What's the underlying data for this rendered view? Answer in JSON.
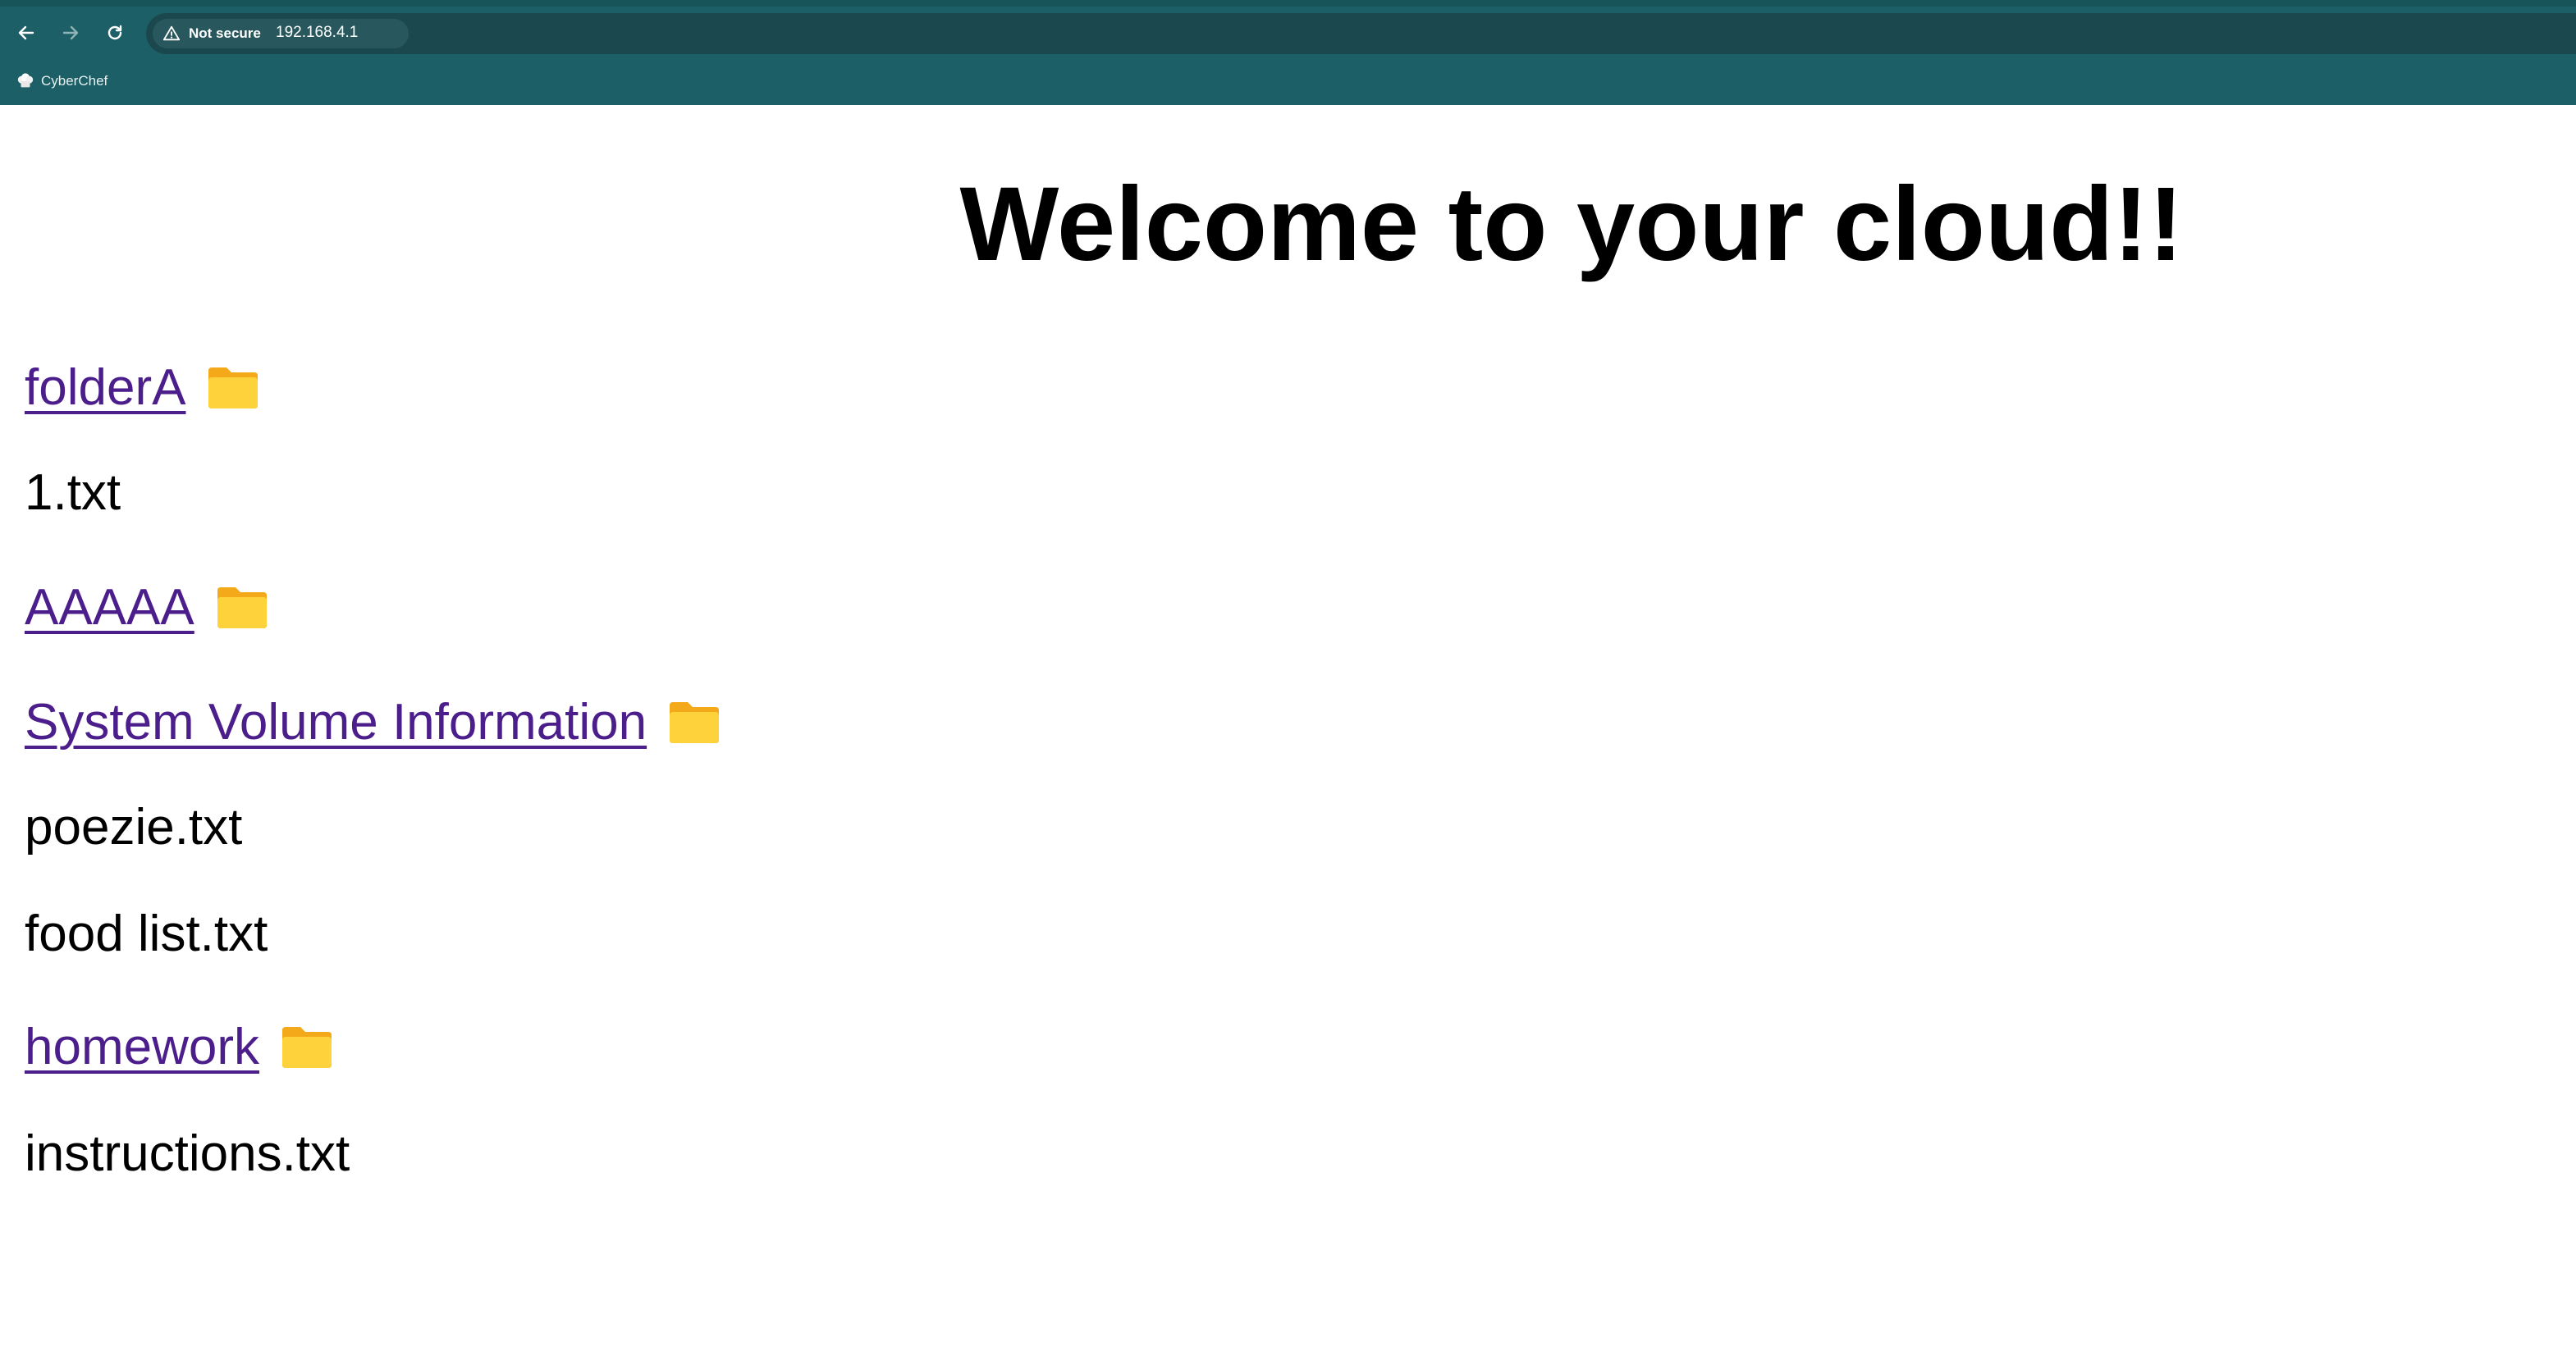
{
  "browser": {
    "security_label": "Not secure",
    "url": "192.168.4.1",
    "bookmarks": [
      {
        "label": "CyberChef",
        "icon": "chef-hat-icon"
      }
    ],
    "colors": {
      "frame": "#1c5f66",
      "omnibox": "#1b484e"
    }
  },
  "page": {
    "title": "Welcome to your cloud!!",
    "entries": [
      {
        "name": "folderA",
        "type": "folder",
        "icon": "folder-icon"
      },
      {
        "name": "1.txt",
        "type": "file"
      },
      {
        "name": "AAAAA",
        "type": "folder",
        "icon": "folder-icon"
      },
      {
        "name": "System Volume Information",
        "type": "folder",
        "icon": "folder-icon"
      },
      {
        "name": "poezie.txt",
        "type": "file"
      },
      {
        "name": "food list.txt",
        "type": "file"
      },
      {
        "name": "homework",
        "type": "folder",
        "icon": "folder-icon"
      },
      {
        "name": "instructions.txt",
        "type": "file"
      }
    ],
    "colors": {
      "link": "#4b1e8c",
      "folder": "#fbc42b"
    }
  }
}
